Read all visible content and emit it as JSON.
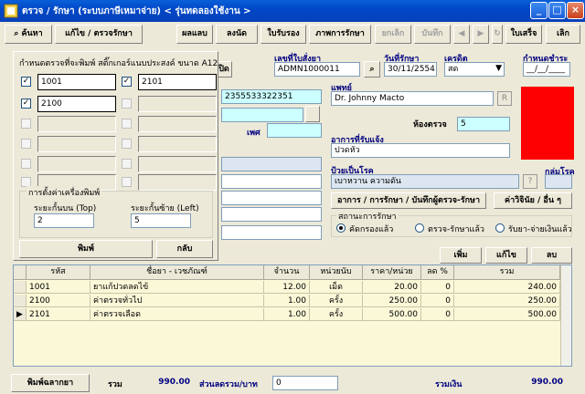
{
  "window": {
    "title": "ตรวจ / รักษา (ระบบภาษีเหมาจ่าย) < รุ่นทดลองใช้งาน >",
    "controls": {
      "minimize": "_",
      "maximize": "□",
      "close": "×"
    }
  },
  "toolbar": {
    "search": "ค้นหา",
    "edit_exam": "แก้ไข / ตรวจรักษา",
    "result": "ผลแลบ",
    "appointment": "ลงนัด",
    "certificate": "ใบรับรอง",
    "treatment_history": "ภาพการรักษา",
    "cancel": "ยกเลิก",
    "save": "บันทึก",
    "nav_first": "◀",
    "nav_next": "▶",
    "receipt": "ใบเสร็จ",
    "exit": "เลิก"
  },
  "popup": {
    "title": "กำหนดตรวจที่จะพิมพ์ สติ๊กเกอร์แนบประสงค์  ขนาด A12",
    "left_column": [
      {
        "checked": true,
        "value": "1001"
      },
      {
        "checked": true,
        "value": "2100"
      },
      {
        "checked": false,
        "value": ""
      },
      {
        "checked": false,
        "value": ""
      },
      {
        "checked": false,
        "value": ""
      },
      {
        "checked": false,
        "value": ""
      }
    ],
    "right_column": [
      {
        "checked": true,
        "value": "2101"
      },
      {
        "checked": false,
        "value": ""
      },
      {
        "checked": false,
        "value": ""
      },
      {
        "checked": false,
        "value": ""
      },
      {
        "checked": false,
        "value": ""
      },
      {
        "checked": false,
        "value": ""
      }
    ],
    "printer_group": "การตั้งค่าเครื่องพิมพ์",
    "top_margin_label": "ระยะกั้นบน (Top)",
    "top_margin_value": "2",
    "left_margin_label": "ระยะกั้นซ้าย (Left)",
    "left_margin_value": "5",
    "print_button": "พิมพ์",
    "back_button": "กลับ"
  },
  "form": {
    "hidden_button": "ปิด",
    "hn_label": "เลขที่ใบสั่งยา",
    "hn_value": "ADMN1000011",
    "date_label": "วันที่รักษา",
    "date_value": "30/11/2554",
    "credit_label": "เครดิต",
    "credit_value": "สด",
    "due_label": "กำหนดชำระ",
    "due_value": "__/__/____",
    "id_value": "2355533322351",
    "doctor_label": "แพทย์",
    "doctor_value": "Dr. Johnny  Macto",
    "gender_label": "เพศ",
    "room_label": "ห้องตรวจ",
    "room_value": "5",
    "symptom_label": "อาการที่รับแจ้ง",
    "symptom_value": "ปวดหัว",
    "disease_label": "ป้วยเป็นโรค",
    "disease_value": "เบาหวาน ความดัน",
    "group_label": "กลุ่มโรค",
    "treat_button": "อาการ / การรักษา / บันทึกผู้ตรวจ-รักษา",
    "surgery_button": "ค่าวิจินัย / อื่น ๆ",
    "status_group": "สถานะการรักษา",
    "status_options": [
      "คัดกรองแล้ว",
      "ตรวจ-รักษาแล้ว",
      "รับยา-จ่ายเงินแล้ว"
    ],
    "status_selected": 0,
    "colors": {
      "alert_box": "#ff0000"
    }
  },
  "grid_buttons": {
    "add": "เพิ่ม",
    "edit": "แก้ไข",
    "delete": "ลบ"
  },
  "grid": {
    "headers": [
      "รหัส",
      "ชื่อยา - เวชภัณฑ์",
      "จำนวน",
      "หน่วยนับ",
      "ราคา/หน่วย",
      "ลด %",
      "รวม"
    ],
    "rows": [
      [
        "1001",
        "ยาแก้ปวดลดไข้",
        "12.00",
        "เม็ด",
        "20.00",
        "0",
        "240.00"
      ],
      [
        "2100",
        "ค่าตรวจทั่วไป",
        "1.00",
        "ครั้ง",
        "250.00",
        "0",
        "250.00"
      ],
      [
        "2101",
        "ค่าตรวจเลือด",
        "1.00",
        "ครั้ง",
        "500.00",
        "0",
        "500.00"
      ]
    ]
  },
  "footer": {
    "print_label_button": "พิมพ์ฉลากยา",
    "total_label": "รวม",
    "total_value": "990.00",
    "discount_label": "ส่วนลดรวม/บาท",
    "discount_value": "0",
    "net_label": "รวมเงิน",
    "net_value": "990.00"
  }
}
